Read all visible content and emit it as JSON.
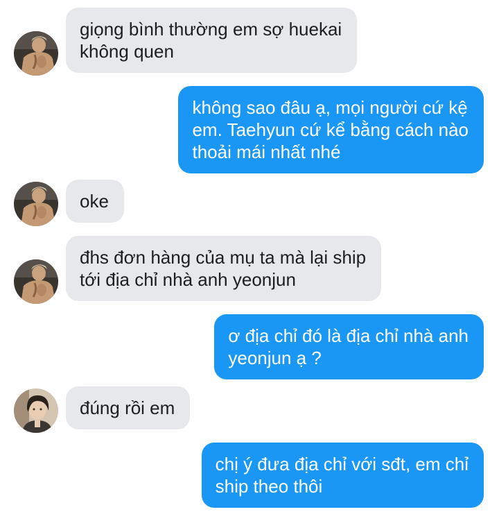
{
  "colors": {
    "incoming_bubble": "#e6e8ec",
    "outgoing_bubble": "#1a97f5",
    "incoming_text": "#1c1e21",
    "outgoing_text": "#ffffff",
    "background": "#ffffff"
  },
  "messages": [
    {
      "direction": "incoming",
      "avatar": "shirtless-man-avatar",
      "text": "giọng bình thường em sợ huekai\nkhông quen"
    },
    {
      "direction": "outgoing",
      "text": "không sao đâu ạ, mọi người cứ kệ\nem. Taehyun cứ kể bằng cách nào\nthoải mái nhất nhé"
    },
    {
      "direction": "incoming",
      "avatar": "shirtless-man-avatar",
      "text": "oke"
    },
    {
      "direction": "incoming",
      "avatar": "shirtless-man-avatar",
      "text": "đhs đơn hàng của mụ ta mà lại ship\ntới địa chỉ nhà anh yeonjun"
    },
    {
      "direction": "outgoing",
      "text": "ơ địa chỉ đó là địa chỉ nhà anh\nyeonjun ạ ?"
    },
    {
      "direction": "incoming",
      "avatar": "dark-haired-man-avatar",
      "text": "đúng rồi em"
    },
    {
      "direction": "outgoing",
      "text": "chị ý đưa địa chỉ với sđt, em chỉ\nship theo thôi"
    }
  ]
}
